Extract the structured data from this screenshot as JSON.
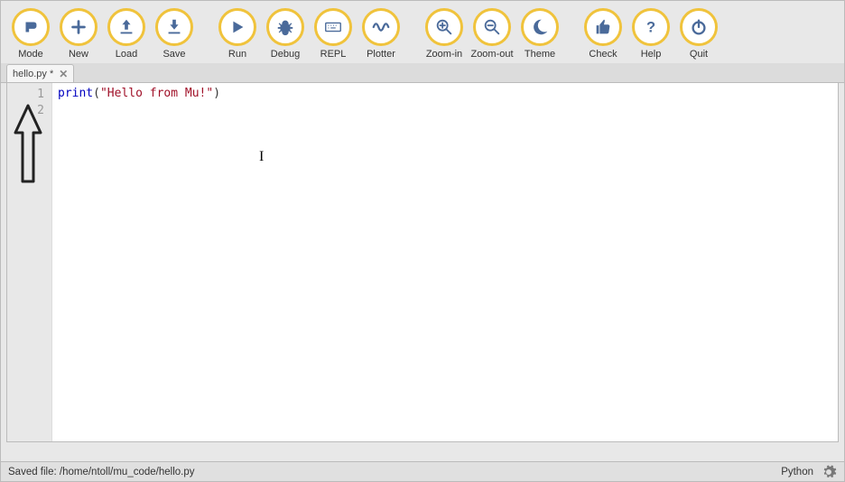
{
  "toolbar": {
    "mode": {
      "label": "Mode",
      "icon": "mode"
    },
    "new": {
      "label": "New",
      "icon": "plus"
    },
    "load": {
      "label": "Load",
      "icon": "load"
    },
    "save": {
      "label": "Save",
      "icon": "save"
    },
    "run": {
      "label": "Run",
      "icon": "play"
    },
    "debug": {
      "label": "Debug",
      "icon": "bug"
    },
    "repl": {
      "label": "REPL",
      "icon": "keyboard"
    },
    "plotter": {
      "label": "Plotter",
      "icon": "wave"
    },
    "zoomin": {
      "label": "Zoom-in",
      "icon": "zoom-in"
    },
    "zoomout": {
      "label": "Zoom-out",
      "icon": "zoom-out"
    },
    "theme": {
      "label": "Theme",
      "icon": "moon"
    },
    "check": {
      "label": "Check",
      "icon": "thumb"
    },
    "help": {
      "label": "Help",
      "icon": "question"
    },
    "quit": {
      "label": "Quit",
      "icon": "power"
    }
  },
  "tab": {
    "title": "hello.py *"
  },
  "editor": {
    "gutter": [
      "1",
      "2"
    ],
    "line1": {
      "fn": "print",
      "open": "(",
      "str": "\"Hello from Mu!\"",
      "close": ")"
    }
  },
  "status": {
    "message": "Saved file: /home/ntoll/mu_code/hello.py",
    "mode": "Python"
  },
  "colors": {
    "accent": "#f0c33c"
  }
}
